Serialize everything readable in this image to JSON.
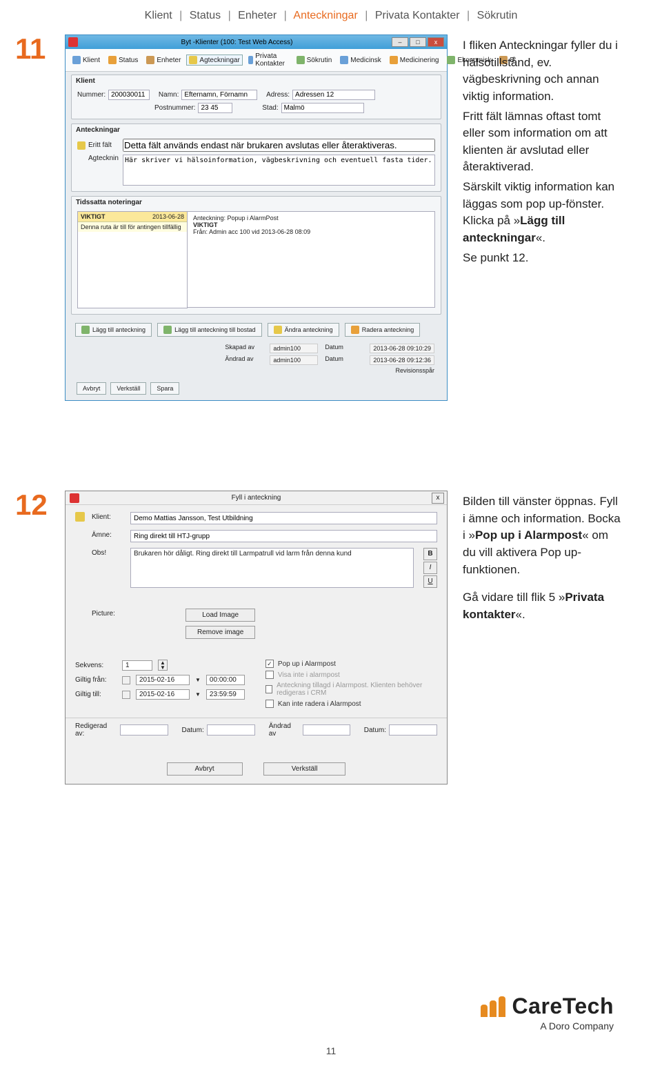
{
  "breadcrumb": {
    "items": [
      "Klient",
      "Status",
      "Enheter",
      "Anteckningar",
      "Privata Kontakter",
      "Sökrutin"
    ],
    "sep": "|",
    "active_index": 3
  },
  "step11": {
    "num": "11",
    "text": {
      "p1a": "I fliken Anteckningar fyller du i hälsotillstånd, ev. vägbeskrivning och annan viktig information.",
      "p1b": "Fritt fält lämnas oftast tomt eller som information om att klienten är avslutad eller återaktiverad.",
      "p1c": "Särskilt viktig information kan läggas som pop up-fönster. Klicka på »Lägg till anteckningar«.",
      "p1d": "Se punkt 12.",
      "bold1": "Lägg till anteckningar"
    },
    "win": {
      "title": "Byt -Klienter (100: Test Web Access)",
      "tabs": [
        "Klient",
        "Status",
        "Enheter",
        "Agteckningar",
        "Privata Kontakter",
        "Sökrutin",
        "Medicinsk",
        "Medicinering",
        "Ekonomisk",
        "B"
      ],
      "klient_label": "Klient",
      "nummer_label": "Nummer:",
      "nummer": "200030011",
      "namn_label": "Namn:",
      "namn": "Efternamn, Förnamn",
      "adress_label": "Adress:",
      "adress": "Adressen 12",
      "post_label": "Postnummer:",
      "post": "23 45",
      "stad_label": "Stad:",
      "stad": "Malmö",
      "anteckningar_label": "Anteckningar",
      "fritt_label": "Eritt fält",
      "fritt_val": "Detta fält används endast när brukaren avslutas eller återaktiveras.",
      "agt_label": "Agtecknin",
      "agt_val": "Här skriver vi hälsoinformation, vägbeskrivning och eventuell fasta tider.",
      "tids_label": "Tidssatta noteringar",
      "viktigt": "VIKTIGT",
      "viktigt_date": "2013-06-28",
      "viktigt_note": "Denna ruta är till för antingen tillfällig",
      "popup_title": "Anteckning: Popup i AlarmPost",
      "popup_h": "VIKTIGT",
      "popup_from": "Från: Admin acc 100 vid 2013-06-28 08:09",
      "btns": [
        "Lägg till anteckning",
        "Lägg till anteckning till bostad",
        "Ändra anteckning",
        "Radera anteckning"
      ],
      "footer": {
        "skapad_l": "Skapad av",
        "skapad_v": "admin100",
        "datum_l": "Datum",
        "skapad_d": "2013-06-28 09:10:29",
        "andrad_l": "Ändrad av",
        "andrad_v": "admin100",
        "andrad_d": "2013-06-28 09:12:36",
        "rev": "Revisionsspår"
      },
      "bottom": [
        "Avbryt",
        "Verkställ",
        "Spara"
      ]
    }
  },
  "step12": {
    "num": "12",
    "text": {
      "p1": "Bilden till vänster öppnas. Fyll i ämne och information. Bocka i »Pop up i Alarmpost« om du vill aktivera Pop up-funktionen.",
      "bold1": "Pop up i Alarmpost",
      "p2a": "Gå vidare till flik 5 »",
      "bold2": "Privata kontakter",
      "p2b": "«."
    },
    "win": {
      "title": "Fyll i anteckning",
      "klient_l": "Klient:",
      "klient_v": "Demo Mattias Jansson, Test Utbildning",
      "amne_l": "Ämne:",
      "amne_v": "Ring direkt till HTJ-grupp",
      "obs_l": "Obs!",
      "obs_v": "Brukaren hör dåligt. Ring direkt till Larmpatrull vid larm från denna kund",
      "fmt": [
        "B",
        "I",
        "U"
      ],
      "picture_l": "Picture:",
      "load_img": "Load Image",
      "remove_img": "Remove image",
      "sekvens_l": "Sekvens:",
      "sekvens_v": "1",
      "giltig_fran_l": "Giltig från:",
      "giltig_fran_d": "2015-02-16",
      "giltig_fran_t": "00:00:00",
      "giltig_till_l": "Giltig till:",
      "giltig_till_d": "2015-02-16",
      "giltig_till_t": "23:59:59",
      "chk1": "Pop up i Alarmpost",
      "chk2": "Visa inte i alarmpost",
      "chk3": "Anteckning tillagd i Alarmpost. Klienten behöver redigeras i CRM",
      "chk4": "Kan inte radera i Alarmpost",
      "redig_l": "Redigerad av:",
      "datum_l": "Datum:",
      "andrad_l": "Ändrad av",
      "bot": [
        "Avbryt",
        "Verkställ"
      ]
    }
  },
  "logo": {
    "brand": "CareTech",
    "tag": "A Doro Company"
  },
  "page_number": "11"
}
